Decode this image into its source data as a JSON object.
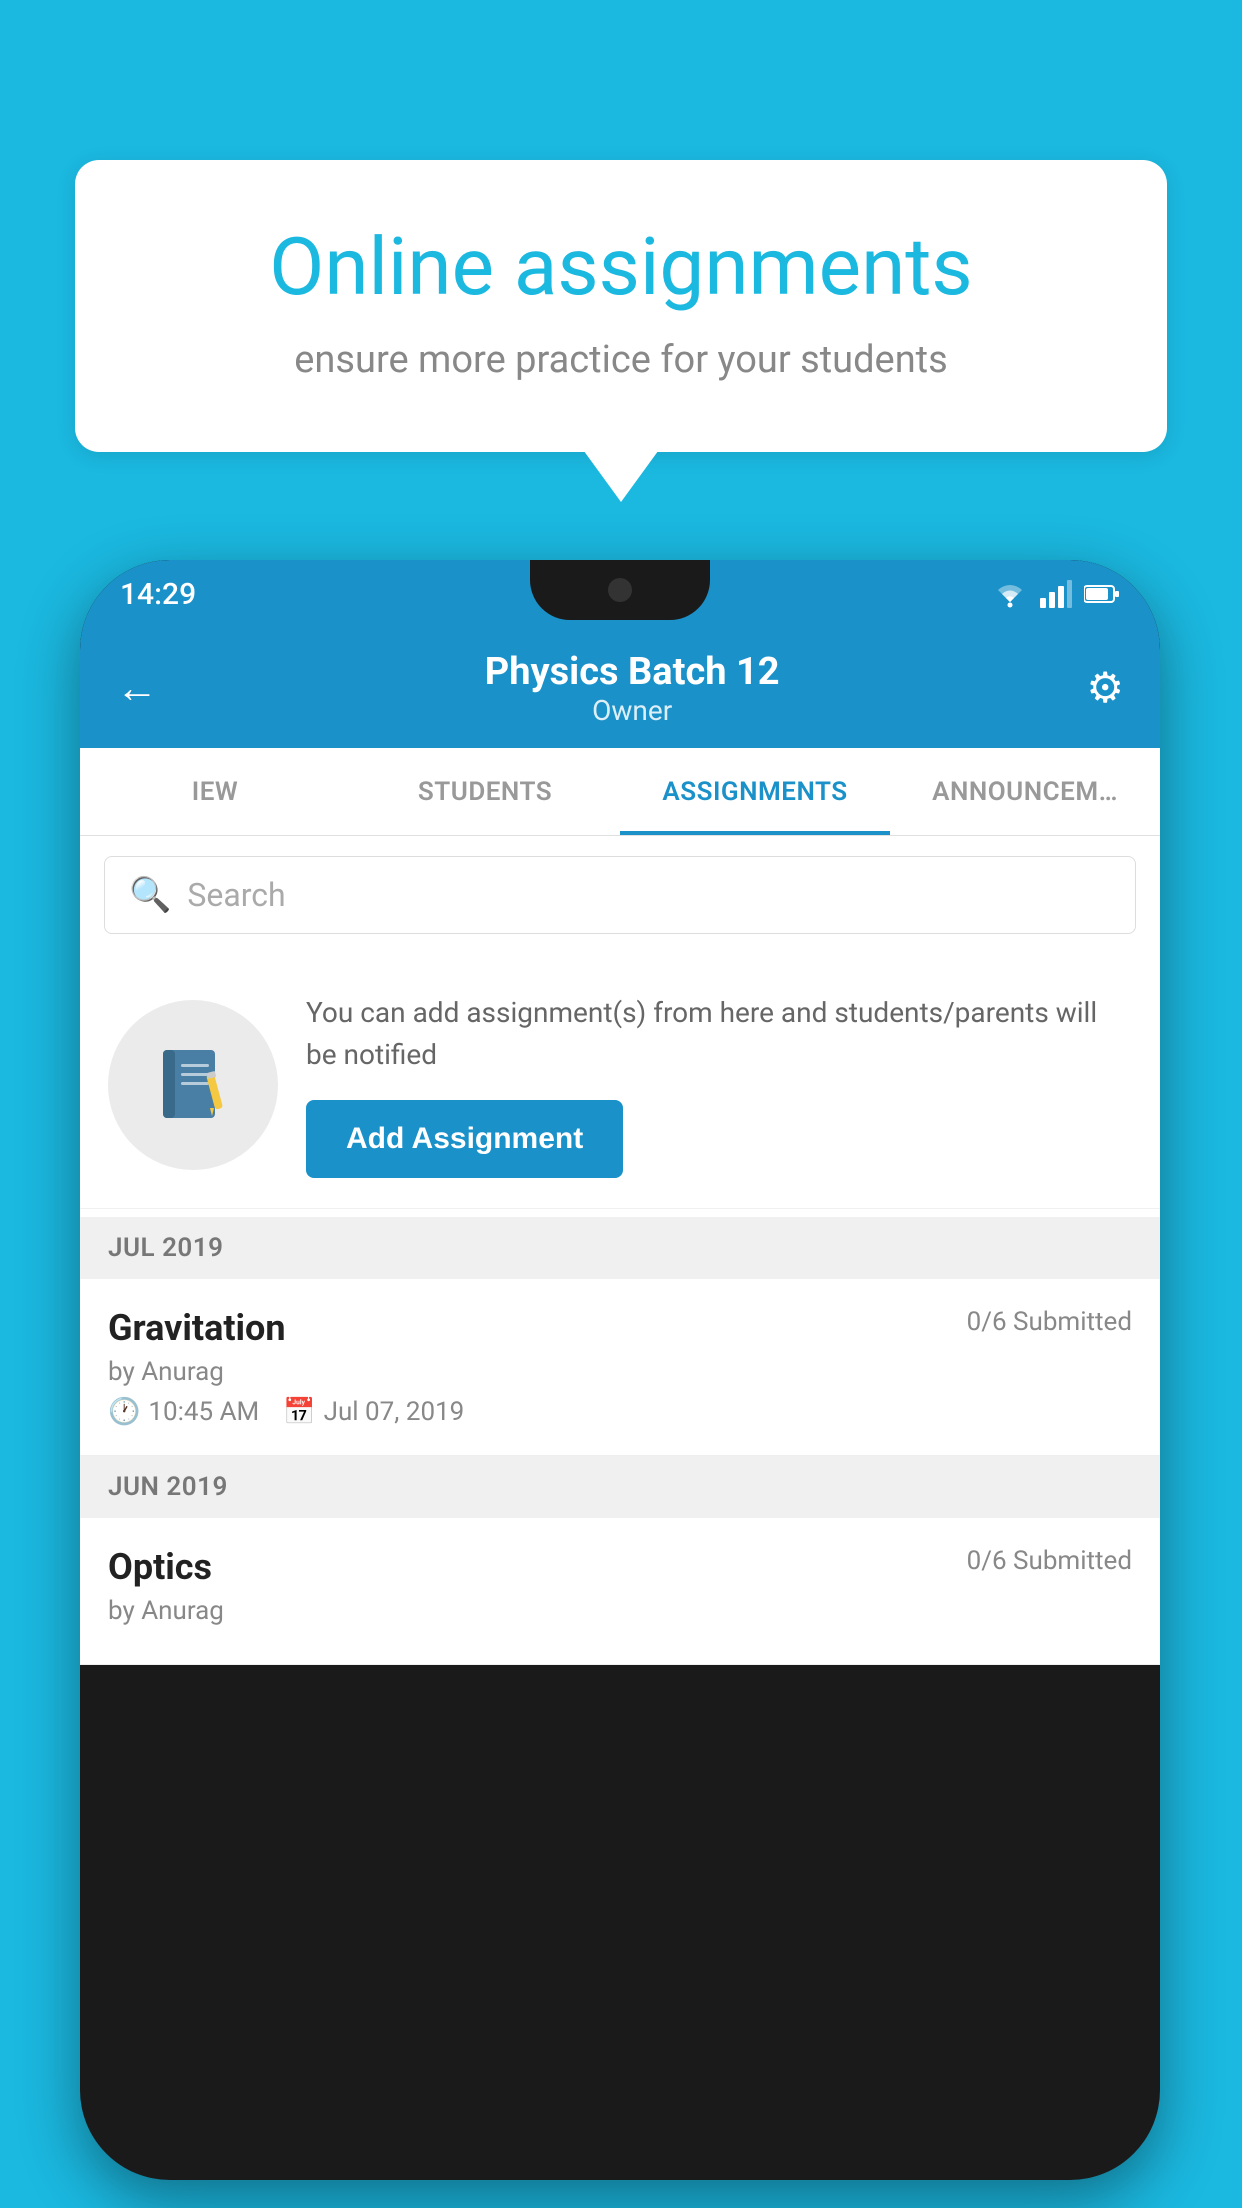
{
  "background": {
    "color": "#1bb8e0"
  },
  "speech_bubble": {
    "title": "Online assignments",
    "subtitle": "ensure more practice for your students"
  },
  "phone": {
    "status_bar": {
      "time": "14:29"
    },
    "header": {
      "title": "Physics Batch 12",
      "subtitle": "Owner",
      "back_label": "←",
      "settings_label": "⚙"
    },
    "tabs": [
      {
        "label": "IEW",
        "active": false
      },
      {
        "label": "STUDENTS",
        "active": false
      },
      {
        "label": "ASSIGNMENTS",
        "active": true
      },
      {
        "label": "ANNOUNCEM…",
        "active": false
      }
    ],
    "search": {
      "placeholder": "Search"
    },
    "info_card": {
      "description": "You can add assignment(s) from here and students/parents will be notified",
      "button_label": "Add Assignment"
    },
    "assignment_groups": [
      {
        "month": "JUL 2019",
        "assignments": [
          {
            "title": "Gravitation",
            "submitted": "0/6 Submitted",
            "by": "by Anurag",
            "time": "10:45 AM",
            "date": "Jul 07, 2019"
          }
        ]
      },
      {
        "month": "JUN 2019",
        "assignments": [
          {
            "title": "Optics",
            "submitted": "0/6 Submitted",
            "by": "by Anurag",
            "time": "",
            "date": ""
          }
        ]
      }
    ]
  }
}
